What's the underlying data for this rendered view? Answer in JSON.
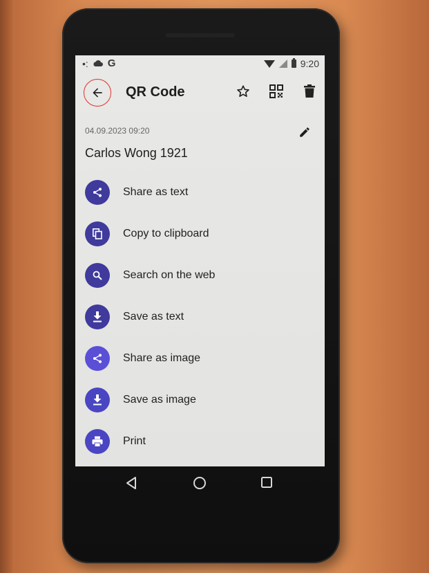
{
  "status_bar": {
    "time": "9:20",
    "carrier_letter": "G"
  },
  "toolbar": {
    "title": "QR Code"
  },
  "record": {
    "date": "04.09.2023 09:20",
    "title": "Carlos Wong 1921"
  },
  "actions": [
    {
      "label": "Share as text",
      "icon": "share-icon",
      "color": "#3f3a9c"
    },
    {
      "label": "Copy to clipboard",
      "icon": "copy-icon",
      "color": "#3f3a9c"
    },
    {
      "label": "Search on the web",
      "icon": "search-icon",
      "color": "#3f3a9c"
    },
    {
      "label": "Save as text",
      "icon": "download-icon",
      "color": "#3f3a9c"
    },
    {
      "label": "Share as image",
      "icon": "share-icon",
      "color": "#5a4fd6"
    },
    {
      "label": "Save as image",
      "icon": "download-icon",
      "color": "#4a45c2"
    },
    {
      "label": "Print",
      "icon": "print-icon",
      "color": "#4a45c2"
    }
  ],
  "colors": {
    "accent": "#3f3a9c",
    "highlight_ring": "#e0302a"
  }
}
